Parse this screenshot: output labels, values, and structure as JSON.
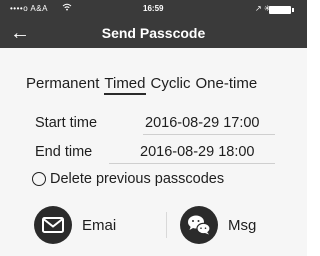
{
  "status_bar": {
    "carrier": "••••o A&A",
    "wifi_icon": "wifi-icon",
    "time": "16:59",
    "right_icons": "↗ ✳",
    "battery_icon": "battery-icon"
  },
  "header": {
    "back_icon": "←",
    "title": "Send Passcode",
    "background": "#3a3a3a"
  },
  "modes": [
    {
      "label": "Permanent",
      "active": false
    },
    {
      "label": "Timed",
      "active": true
    },
    {
      "label": "Cyclic",
      "active": false
    },
    {
      "label": "One-time",
      "active": false
    }
  ],
  "start": {
    "label": "Start time",
    "value": "2016-08-29 17:00"
  },
  "end": {
    "label": "End time",
    "value": "2016-08-29 18:00"
  },
  "delete_option": {
    "label": "Delete previous passcodes",
    "checked": false
  },
  "share": {
    "email": {
      "label": "Emai",
      "icon": "envelope-icon"
    },
    "msg": {
      "label": "Msg",
      "icon": "chat-bubbles-icon"
    }
  }
}
